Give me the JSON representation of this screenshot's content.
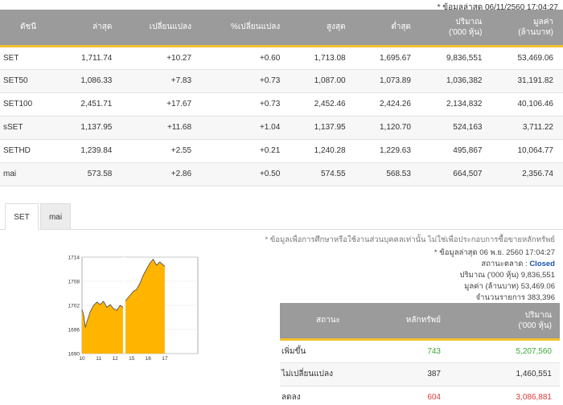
{
  "last_updated": "* ข้อมูลล่าสุด 06/11/2560 17:04:27",
  "index_table": {
    "headers": {
      "name": "ดัชนี",
      "last": "ล่าสุด",
      "change": "เปลี่ยนแปลง",
      "pct_change": "%เปลี่ยนแปลง",
      "high": "สูงสุด",
      "low": "ต่ำสุด",
      "volume_line1": "ปริมาณ",
      "volume_line2": "('000 หุ้น)",
      "value_line1": "มูลค่า",
      "value_line2": "(ล้านบาท)"
    },
    "rows": [
      {
        "name": "SET",
        "last": "1,711.74",
        "change": "+10.27",
        "pct": "+0.60",
        "high": "1,713.08",
        "low": "1,695.67",
        "volume": "9,836,551",
        "value": "53,469.06"
      },
      {
        "name": "SET50",
        "last": "1,086.33",
        "change": "+7.83",
        "pct": "+0.73",
        "high": "1,087.00",
        "low": "1,073.89",
        "volume": "1,036,382",
        "value": "31,191.82"
      },
      {
        "name": "SET100",
        "last": "2,451.71",
        "change": "+17.67",
        "pct": "+0.73",
        "high": "2,452.46",
        "low": "2,424.26",
        "volume": "2,134,832",
        "value": "40,106.46"
      },
      {
        "name": "sSET",
        "last": "1,137.95",
        "change": "+11.68",
        "pct": "+1.04",
        "high": "1,137.95",
        "low": "1,120.70",
        "volume": "524,163",
        "value": "3,711.22"
      },
      {
        "name": "SETHD",
        "last": "1,239.84",
        "change": "+2.55",
        "pct": "+0.21",
        "high": "1,240.28",
        "low": "1,229.63",
        "volume": "495,867",
        "value": "10,064.77"
      },
      {
        "name": "mai",
        "last": "573.58",
        "change": "+2.86",
        "pct": "+0.50",
        "high": "574.55",
        "low": "568.53",
        "volume": "664,507",
        "value": "2,356.74"
      }
    ]
  },
  "tabs": [
    "SET",
    "mai"
  ],
  "chart_data": {
    "type": "area",
    "y_ticks": [
      "1714",
      "1708",
      "1702",
      "1696",
      "1690"
    ],
    "x_ticks": [
      "10",
      "11",
      "12",
      "15",
      "16",
      "17"
    ],
    "ylim": [
      1690,
      1714
    ],
    "x": [
      10.0,
      10.1,
      10.2,
      10.3,
      10.5,
      10.7,
      10.9,
      11.1,
      11.3,
      11.5,
      11.7,
      11.9,
      12.1,
      12.3,
      12.5,
      14.5,
      14.7,
      14.9,
      15.1,
      15.3,
      15.5,
      15.7,
      15.9,
      16.1,
      16.3,
      16.5,
      16.7,
      17.0
    ],
    "values": [
      1701.0,
      1699.5,
      1696.5,
      1698.0,
      1700.5,
      1702.0,
      1702.8,
      1702.2,
      1703.0,
      1701.5,
      1702.2,
      1701.2,
      1700.8,
      1702.0,
      1701.5,
      1702.5,
      1703.5,
      1704.5,
      1705.5,
      1706.0,
      1707.5,
      1709.5,
      1711.0,
      1712.5,
      1713.5,
      1712.0,
      1712.8,
      1711.7
    ]
  },
  "disclaimer": "* ข้อมูลเพื่อการศึกษาหรือใช้งานส่วนบุคคลเท่านั้น ไม่ใช่เพื่อประกอบการซื้อขายหลักทรัพย์",
  "market_info": {
    "updated": "* ข้อมูลล่าสุด 06 พ.ย. 2560 17:04:27",
    "status_label": "สถานะตลาด :",
    "status_value": "Closed",
    "volume": "ปริมาณ ('000 หุ้น)  9,836,551",
    "value": "มูลค่า (ล้านบาท)  53,469.06",
    "transactions": "จำนวนรายการ  383,396"
  },
  "stat_table": {
    "headers": {
      "status": "สถานะ",
      "securities": "หลักทรัพย์",
      "volume_line1": "ปริมาณ",
      "volume_line2": "('000 หุ้น)"
    },
    "rows": [
      {
        "status": "เพิ่มขึ้น",
        "count": "743",
        "volume": "5,207,560"
      },
      {
        "status": "ไม่เปลี่ยนแปลง",
        "count": "387",
        "volume": "1,460,551"
      },
      {
        "status": "ลดลง",
        "count": "604",
        "volume": "3,086,881"
      }
    ]
  },
  "colors": {
    "header_bg": "#9b9b9b",
    "accent": "#f2c12e",
    "up": "#3aa935",
    "down": "#e23a3a",
    "link": "#2e88c9",
    "chart_fill": "#ffb400"
  }
}
